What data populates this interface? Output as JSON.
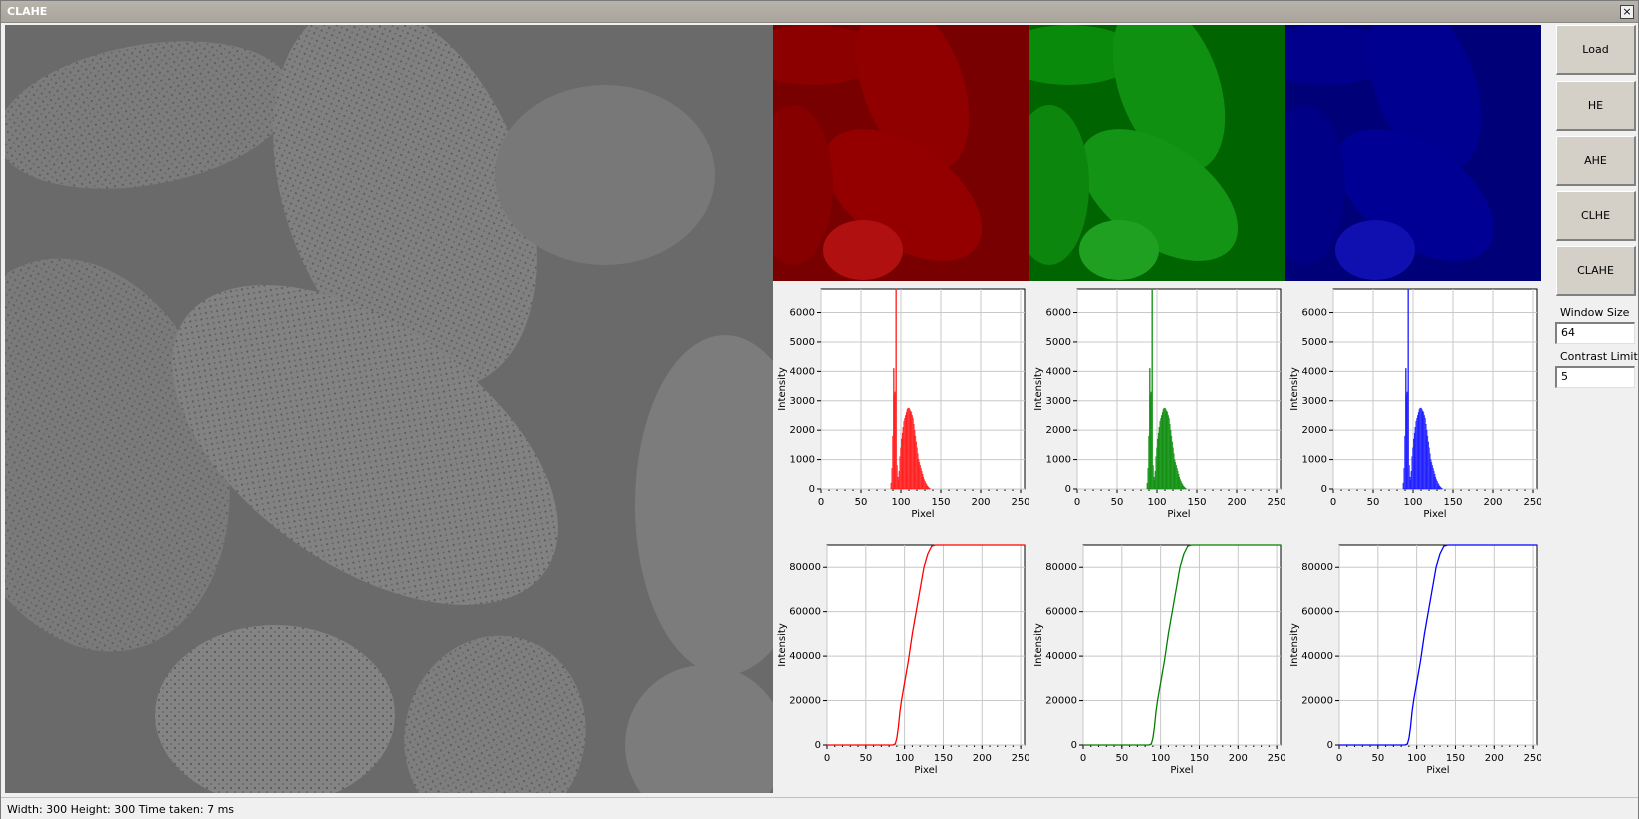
{
  "window": {
    "title": "CLAHE",
    "close_glyph": "×"
  },
  "main_image": {
    "description_icon": "grayscale-pollen-image"
  },
  "channels": [
    {
      "name": "red",
      "color": "#ff0000",
      "tile_color": "#7a0000",
      "hist_color": "#ff6060"
    },
    {
      "name": "green",
      "color": "#008000",
      "tile_color": "#006600",
      "hist_color": "#40b040"
    },
    {
      "name": "blue",
      "color": "#0000ff",
      "tile_color": "#00007a",
      "hist_color": "#6060ff"
    }
  ],
  "buttons": {
    "load": "Load",
    "he": "HE",
    "ahe": "AHE",
    "clhe": "CLHE",
    "clahe": "CLAHE"
  },
  "fields": {
    "window_size_label": "Window Size",
    "window_size_value": "64",
    "contrast_limit_label": "Contrast Limit",
    "contrast_limit_value": "5"
  },
  "status": {
    "text": "Width: 300 Height: 300 Time taken: 7 ms"
  },
  "chart_data": [
    {
      "type": "bar",
      "title": "",
      "xlabel": "Pixel",
      "ylabel": "Intensity",
      "xlim": [
        0,
        255
      ],
      "ylim": [
        0,
        6800
      ],
      "xticks": [
        "0",
        "50",
        "100",
        "150",
        "200",
        "250"
      ],
      "yticks": [
        "0",
        "1000",
        "2000",
        "3000",
        "4000",
        "5000",
        "6000"
      ],
      "grid": true,
      "series": [
        {
          "x": [
            88,
            89,
            90,
            91,
            92,
            93,
            94,
            95,
            96,
            97,
            98,
            99,
            100,
            101,
            102,
            103,
            104,
            105,
            106,
            107,
            108,
            109,
            110,
            111,
            112,
            113,
            114,
            115,
            116,
            117,
            118,
            119,
            120,
            121,
            122,
            123,
            124,
            125,
            126,
            127,
            128,
            129,
            130,
            131,
            132,
            133,
            134,
            135,
            136
          ],
          "values": [
            200,
            700,
            1800,
            4100,
            3200,
            3300,
            7000,
            800,
            400,
            300,
            600,
            1100,
            1400,
            1700,
            1900,
            2100,
            2300,
            2400,
            2500,
            2600,
            2700,
            2750,
            2750,
            2700,
            2650,
            2600,
            2500,
            2400,
            2200,
            2000,
            1800,
            1600,
            1400,
            1200,
            1000,
            900,
            800,
            700,
            600,
            500,
            400,
            320,
            260,
            200,
            150,
            100,
            70,
            40,
            20
          ]
        }
      ]
    },
    {
      "type": "line",
      "title": "",
      "xlabel": "Pixel",
      "ylabel": "Intensity",
      "xlim": [
        0,
        255
      ],
      "ylim": [
        0,
        90000
      ],
      "xticks": [
        "0",
        "50",
        "100",
        "150",
        "200",
        "250"
      ],
      "yticks": [
        "0",
        "20000",
        "40000",
        "60000",
        "80000"
      ],
      "grid": true,
      "series": [
        {
          "x": [
            0,
            85,
            88,
            90,
            92,
            94,
            96,
            98,
            100,
            105,
            110,
            115,
            120,
            125,
            130,
            135,
            140,
            255
          ],
          "values": [
            0,
            0,
            500,
            3000,
            8000,
            15000,
            20000,
            24000,
            28000,
            38000,
            50000,
            60000,
            70000,
            80000,
            86000,
            89500,
            90000,
            90000
          ]
        }
      ]
    }
  ]
}
